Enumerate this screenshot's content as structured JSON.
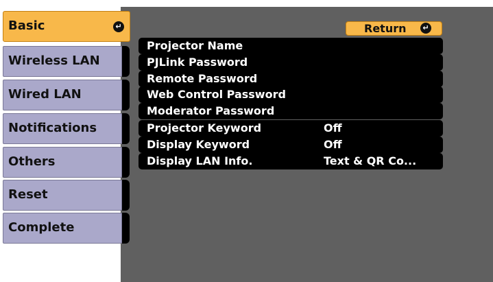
{
  "sidebar": {
    "items": [
      {
        "label": "Basic",
        "active": true
      },
      {
        "label": "Wireless LAN",
        "active": false
      },
      {
        "label": "Wired LAN",
        "active": false
      },
      {
        "label": "Notifications",
        "active": false
      },
      {
        "label": "Others",
        "active": false
      },
      {
        "label": "Reset",
        "active": false
      },
      {
        "label": "Complete",
        "active": false
      }
    ],
    "enter_icon": "enter-icon"
  },
  "main": {
    "return_label": "Return",
    "return_icon": "enter-icon",
    "rows": [
      {
        "label": "Projector Name",
        "value": ""
      },
      {
        "label": "PJLink Password",
        "value": ""
      },
      {
        "label": "Remote Password",
        "value": ""
      },
      {
        "label": "Web Control Password",
        "value": ""
      },
      {
        "label": "Moderator Password",
        "value": ""
      },
      {
        "label": "Projector Keyword",
        "value": "Off"
      },
      {
        "label": "Display Keyword",
        "value": "Off"
      },
      {
        "label": "Display LAN Info.",
        "value": "Text & QR Co..."
      }
    ]
  },
  "colors": {
    "active_tab": "#f8b84a",
    "inactive_tab": "#aaa8ca",
    "panel_bg": "#606060",
    "row_bg": "#000000"
  }
}
